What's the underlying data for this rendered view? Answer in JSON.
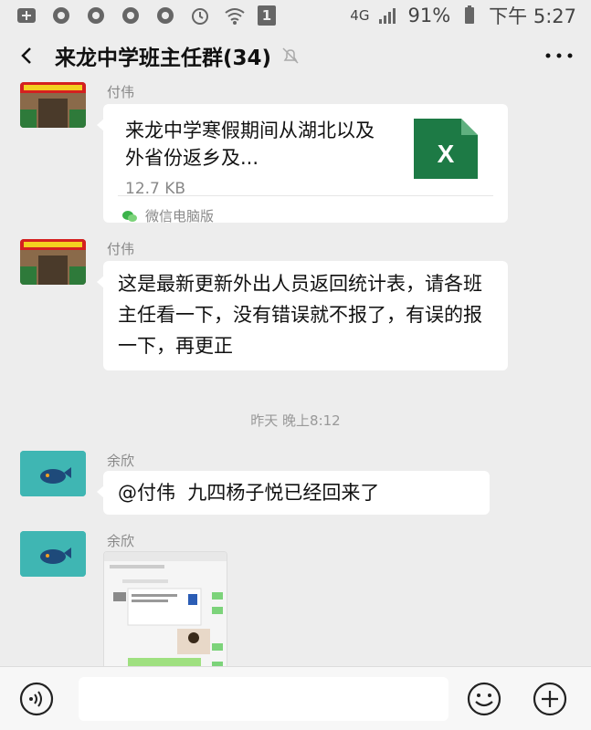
{
  "status_bar": {
    "network": "4G",
    "battery": "91%",
    "time": "下午 5:27",
    "sim": "1"
  },
  "header": {
    "title": "来龙中学班主任群(34)"
  },
  "messages": {
    "m1": {
      "sender": "付伟",
      "file_name": "来龙中学寒假期间从湖北以及外省份返乡及...",
      "file_size": "12.7 KB",
      "source": "微信电脑版",
      "file_icon_letter": "X"
    },
    "m2": {
      "sender": "付伟",
      "text": "这是最新更新外出人员返回统计表，请各班主任看一下，没有错误就不报了，有误的报一下，再更正"
    },
    "timestamp": "昨天 晚上8:12",
    "m3": {
      "sender": "余欣",
      "text": "@付伟  九四杨子悦已经回来了"
    },
    "m4": {
      "sender": "余欣"
    }
  },
  "colors": {
    "background": "#ededed",
    "bubble": "#ffffff",
    "excel_green": "#1d7a45",
    "avatar_teal": "#3fb6b3"
  },
  "icons": {
    "back": "back-arrow-icon",
    "mute": "mute-bell-icon",
    "more": "more-dots-icon",
    "voice": "voice-icon",
    "emoji": "emoji-icon",
    "plus": "plus-icon"
  }
}
